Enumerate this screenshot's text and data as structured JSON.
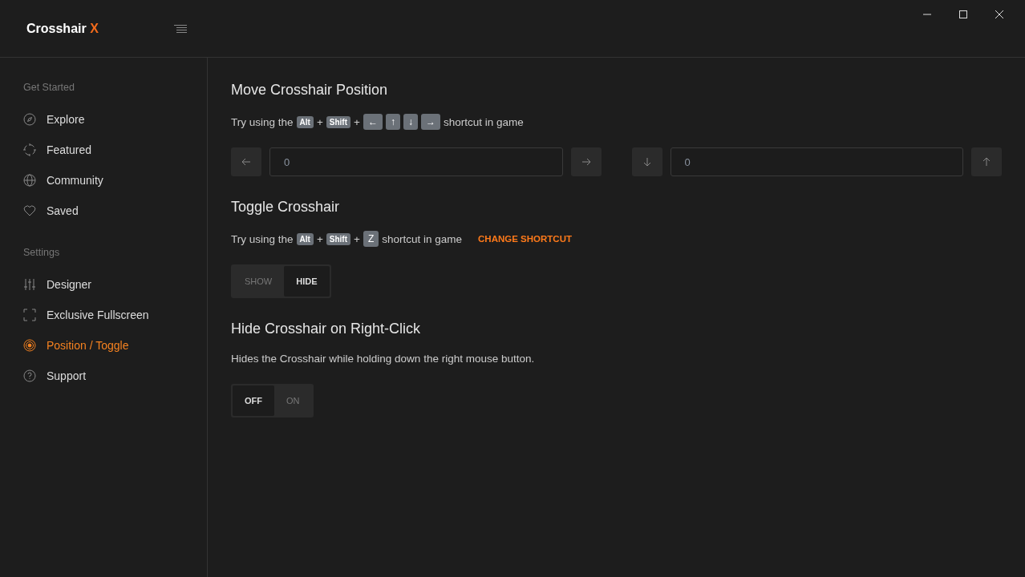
{
  "app": {
    "name": "Crosshair",
    "accent": "X"
  },
  "sidebar": {
    "sections": [
      {
        "heading": "Get Started",
        "items": [
          {
            "label": "Explore",
            "kind": "compass",
            "selected": false
          },
          {
            "label": "Featured",
            "kind": "crosshair",
            "selected": false
          },
          {
            "label": "Community",
            "kind": "globe",
            "selected": false
          },
          {
            "label": "Saved",
            "kind": "heart",
            "selected": false
          }
        ]
      },
      {
        "heading": "Settings",
        "items": [
          {
            "label": "Designer",
            "kind": "sliders",
            "selected": false
          },
          {
            "label": "Exclusive Fullscreen",
            "kind": "frame",
            "selected": false
          },
          {
            "label": "Position / Toggle",
            "kind": "target",
            "selected": true
          },
          {
            "label": "Support",
            "kind": "help",
            "selected": false
          }
        ]
      }
    ]
  },
  "sections": [
    {
      "kind": "position",
      "title": "Move Crosshair Position",
      "hint": [
        {
          "kind": "text",
          "text": "Try using the"
        },
        {
          "kind": "key",
          "text": "Alt"
        },
        {
          "kind": "text",
          "text": "+"
        },
        {
          "kind": "key",
          "text": "Shift"
        },
        {
          "kind": "text",
          "text": "+"
        },
        {
          "kind": "key",
          "text": "←"
        },
        {
          "kind": "key",
          "text": "↑"
        },
        {
          "kind": "key",
          "text": "↓"
        },
        {
          "kind": "key",
          "text": "→"
        },
        {
          "kind": "text",
          "text": "shortcut in game"
        }
      ],
      "x_value": "0",
      "y_value": "0"
    },
    {
      "kind": "toggle",
      "title": "Toggle Crosshair",
      "hint": [
        {
          "kind": "text",
          "text": "Try using the"
        },
        {
          "kind": "key",
          "text": "Alt"
        },
        {
          "kind": "text",
          "text": "+"
        },
        {
          "kind": "key",
          "text": "Shift"
        },
        {
          "kind": "text",
          "text": "+"
        },
        {
          "kind": "key",
          "text": "Z"
        },
        {
          "kind": "text",
          "text": "shortcut in game"
        }
      ],
      "link": "CHANGE SHORTCUT",
      "options": [
        {
          "label": "SHOW",
          "selected": false
        },
        {
          "label": "HIDE",
          "selected": true
        }
      ]
    },
    {
      "kind": "toggle",
      "title": "Hide Crosshair on Right-Click",
      "description": "Hides the Crosshair while holding down the right mouse button.",
      "options": [
        {
          "label": "OFF",
          "selected": true
        },
        {
          "label": "ON",
          "selected": false
        }
      ]
    }
  ]
}
